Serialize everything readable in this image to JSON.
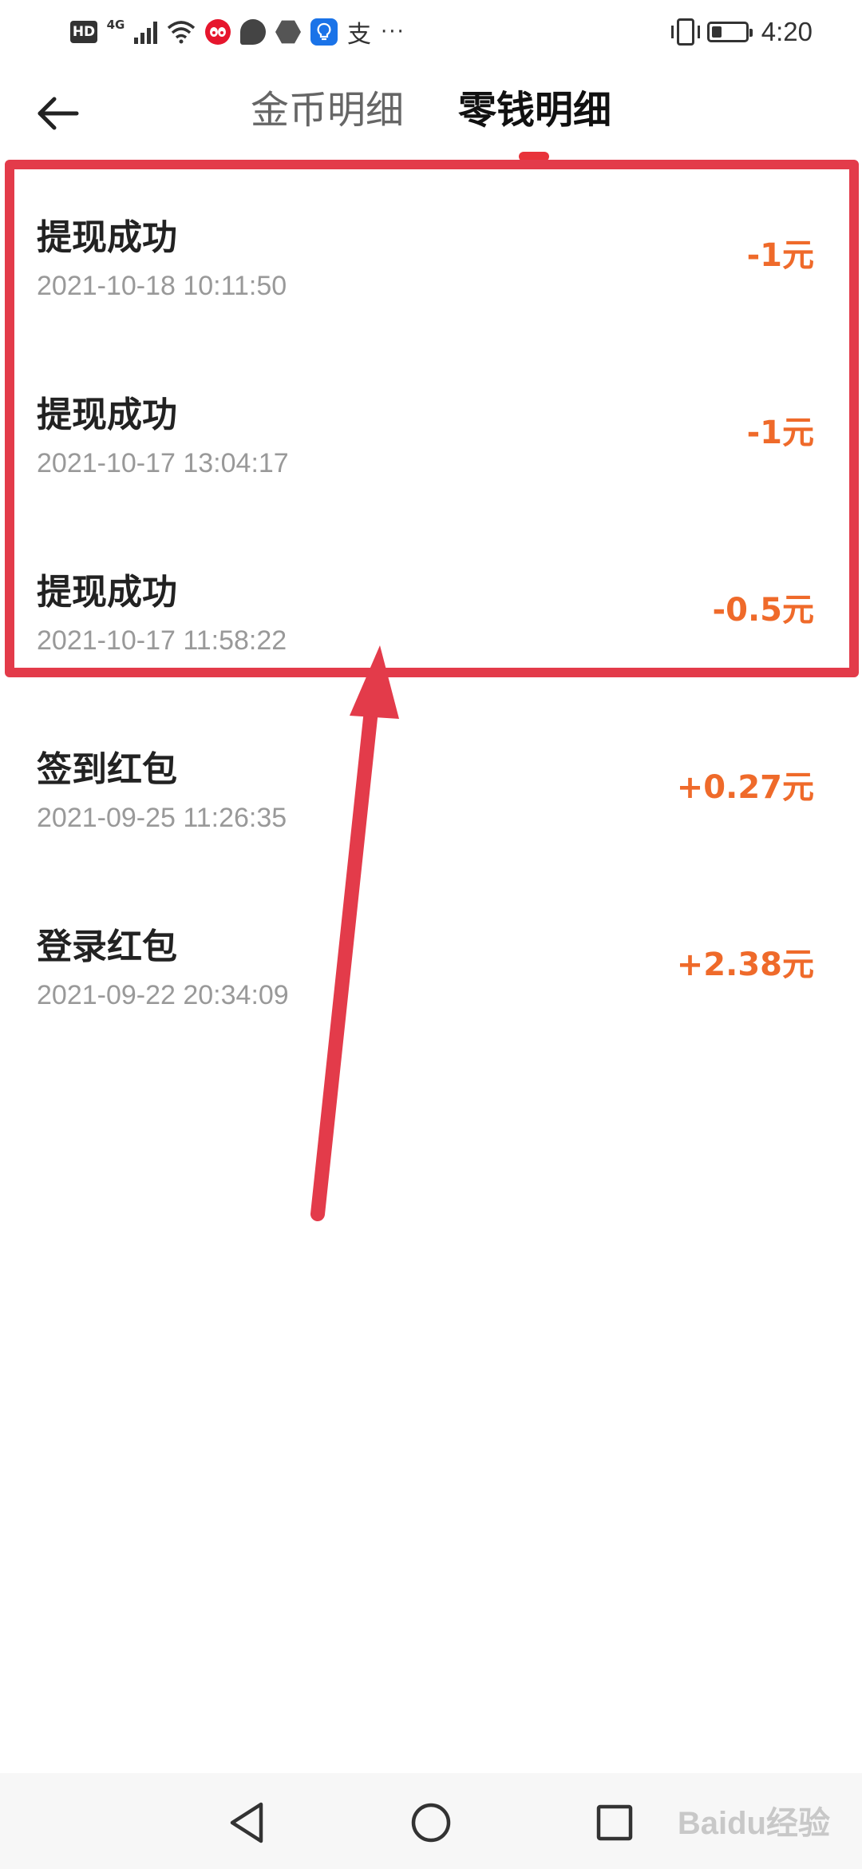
{
  "status_bar": {
    "hd": "HD",
    "network": "4G",
    "app_icon_zhi": "支",
    "more": "···",
    "battery_level": 0.3,
    "time": "4:20"
  },
  "header": {
    "tabs": [
      {
        "label": "金币明细",
        "selected": false
      },
      {
        "label": "零钱明细",
        "selected": true
      }
    ]
  },
  "transactions": [
    {
      "title": "提现成功",
      "time": "2021-10-18 10:11:50",
      "amount": "-1元"
    },
    {
      "title": "提现成功",
      "time": "2021-10-17 13:04:17",
      "amount": "-1元"
    },
    {
      "title": "提现成功",
      "time": "2021-10-17 11:58:22",
      "amount": "-0.5元"
    },
    {
      "title": "签到红包",
      "time": "2021-09-25 11:26:35",
      "amount": "+0.27元"
    },
    {
      "title": "登录红包",
      "time": "2021-09-22 20:34:09",
      "amount": "+2.38元"
    }
  ],
  "colors": {
    "amount": "#ef6a2a",
    "accent": "#e8323a",
    "annotation": "#e33b4a"
  },
  "watermark": "Baidu经验"
}
